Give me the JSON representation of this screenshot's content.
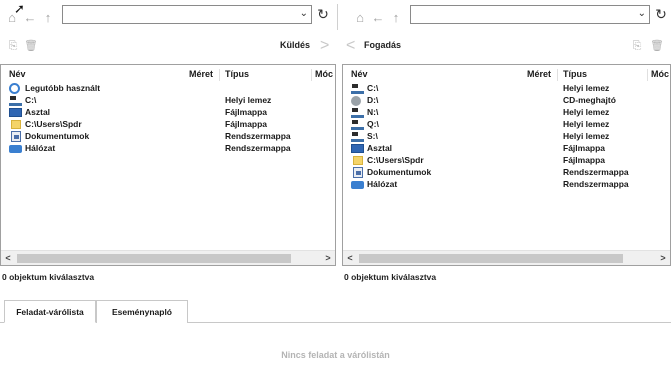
{
  "left_pane": {
    "toolbar": {
      "transfer_label": "Küldés"
    },
    "columns": {
      "name": "Név",
      "size": "Méret",
      "type": "Típus",
      "modified": "Móc"
    },
    "items": [
      {
        "name": "Legutóbb használt",
        "type": "",
        "icon": "recent-icon"
      },
      {
        "name": "C:\\",
        "type": "Helyi lemez",
        "icon": "drive-icon"
      },
      {
        "name": "Asztal",
        "type": "Fájlmappa",
        "icon": "desktop-folder-icon"
      },
      {
        "name": "C:\\Users\\Spdr",
        "type": "Fájlmappa",
        "icon": "folder-icon"
      },
      {
        "name": "Dokumentumok",
        "type": "Rendszermappa",
        "icon": "documents-icon"
      },
      {
        "name": "Hálózat",
        "type": "Rendszermappa",
        "icon": "network-icon"
      }
    ],
    "status": "0 objektum kiválasztva"
  },
  "right_pane": {
    "toolbar": {
      "transfer_label": "Fogadás"
    },
    "columns": {
      "name": "Név",
      "size": "Méret",
      "type": "Típus",
      "modified": "Móc"
    },
    "items": [
      {
        "name": "C:\\",
        "type": "Helyi lemez",
        "icon": "drive-icon"
      },
      {
        "name": "D:\\",
        "type": "CD-meghajtó",
        "icon": "cd-drive-icon"
      },
      {
        "name": "N:\\",
        "type": "Helyi lemez",
        "icon": "drive-icon"
      },
      {
        "name": "Q:\\",
        "type": "Helyi lemez",
        "icon": "drive-icon"
      },
      {
        "name": "S:\\",
        "type": "Helyi lemez",
        "icon": "drive-icon"
      },
      {
        "name": "Asztal",
        "type": "Fájlmappa",
        "icon": "desktop-folder-icon"
      },
      {
        "name": "C:\\Users\\Spdr",
        "type": "Fájlmappa",
        "icon": "folder-icon"
      },
      {
        "name": "Dokumentumok",
        "type": "Rendszermappa",
        "icon": "documents-icon"
      },
      {
        "name": "Hálózat",
        "type": "Rendszermappa",
        "icon": "network-icon"
      }
    ],
    "status": "0 objektum kiválasztva"
  },
  "bottom": {
    "tabs": [
      {
        "label": "Feladat-várólista",
        "active": true
      },
      {
        "label": "Eseménynapló",
        "active": false
      }
    ],
    "empty_message": "Nincs feladat a várólistán"
  }
}
